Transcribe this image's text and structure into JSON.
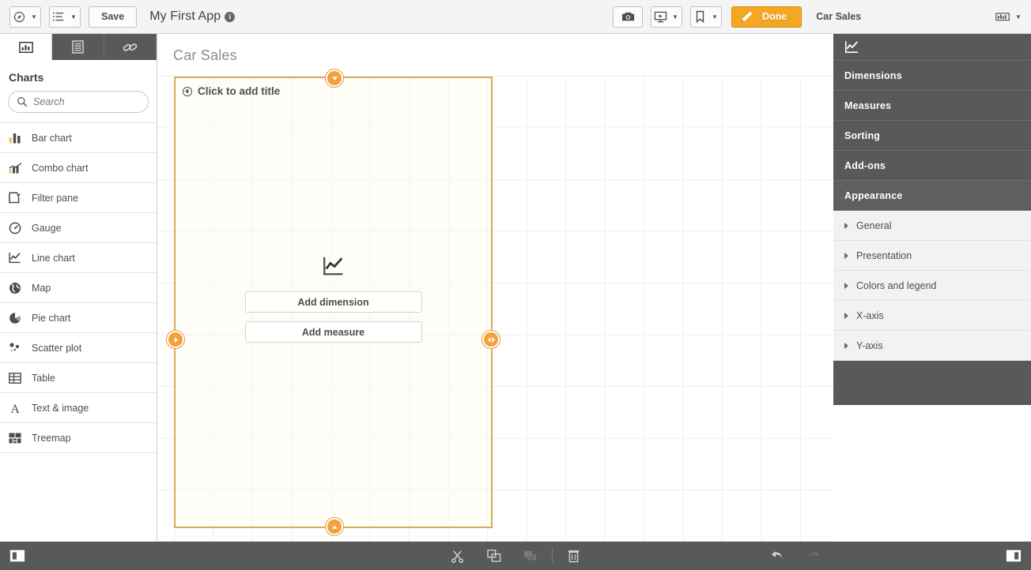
{
  "topbar": {
    "nav_icon": "navigation-compass-icon",
    "sheets_icon": "sheet-list-icon",
    "save_label": "Save",
    "app_name": "My First App",
    "info_icon": "info-icon",
    "snapshot_icon": "camera-icon",
    "storytelling_icon": "presentation-icon",
    "bookmark_icon": "bookmark-icon",
    "edit_icon": "pencil-icon",
    "done_label": "Done",
    "sheet_name": "Car Sales",
    "selections_icon": "selections-icon"
  },
  "left_panel": {
    "tabs": [
      {
        "name": "charts-tab",
        "icon": "bar-chart-icon",
        "active": true
      },
      {
        "name": "fields-tab",
        "icon": "list-icon",
        "active": false
      },
      {
        "name": "master-items-tab",
        "icon": "link-icon",
        "active": false
      }
    ],
    "title": "Charts",
    "search": {
      "placeholder": "Search",
      "value": ""
    },
    "items": [
      {
        "label": "Bar chart",
        "icon": "bar-chart-icon"
      },
      {
        "label": "Combo chart",
        "icon": "combo-chart-icon"
      },
      {
        "label": "Filter pane",
        "icon": "filter-pane-icon"
      },
      {
        "label": "Gauge",
        "icon": "gauge-icon"
      },
      {
        "label": "Line chart",
        "icon": "line-chart-icon"
      },
      {
        "label": "Map",
        "icon": "map-icon"
      },
      {
        "label": "Pie chart",
        "icon": "pie-chart-icon"
      },
      {
        "label": "Scatter plot",
        "icon": "scatter-plot-icon"
      },
      {
        "label": "Table",
        "icon": "table-icon"
      },
      {
        "label": "Text & image",
        "icon": "text-image-icon"
      },
      {
        "label": "Treemap",
        "icon": "treemap-icon"
      }
    ]
  },
  "canvas": {
    "sheet_title": "Car Sales",
    "object": {
      "title_placeholder": "Click to add title",
      "chart_icon": "line-chart-icon",
      "add_dimension_label": "Add dimension",
      "add_measure_label": "Add measure",
      "handles": {
        "top": "chevron-down-handle",
        "bottom": "chevron-up-handle",
        "left": "chevron-right-handle",
        "right": "chevron-left-right-handle"
      }
    }
  },
  "right_panel": {
    "header_icon": "line-chart-icon",
    "sections": [
      {
        "label": "Dimensions",
        "open": false
      },
      {
        "label": "Measures",
        "open": false
      },
      {
        "label": "Sorting",
        "open": false
      },
      {
        "label": "Add-ons",
        "open": false
      },
      {
        "label": "Appearance",
        "open": true
      }
    ],
    "appearance_items": [
      {
        "label": "General"
      },
      {
        "label": "Presentation"
      },
      {
        "label": "Colors and legend"
      },
      {
        "label": "X-axis"
      },
      {
        "label": "Y-axis"
      }
    ]
  },
  "bottom_bar": {
    "left_toggle_icon": "left-panel-toggle-icon",
    "right_toggle_icon": "right-panel-toggle-icon",
    "actions": [
      {
        "icon": "cut-icon",
        "enabled": true
      },
      {
        "icon": "copy-icon",
        "enabled": true
      },
      {
        "icon": "paste-icon",
        "enabled": false
      },
      {
        "icon": "trash-icon",
        "enabled": true
      }
    ],
    "history": [
      {
        "icon": "undo-icon",
        "enabled": true
      },
      {
        "icon": "redo-icon",
        "enabled": false
      }
    ]
  },
  "colors": {
    "accent": "#f5a623",
    "panel_dark": "#595959",
    "object_border": "#dcab5a",
    "text": "#4d4d4d"
  }
}
